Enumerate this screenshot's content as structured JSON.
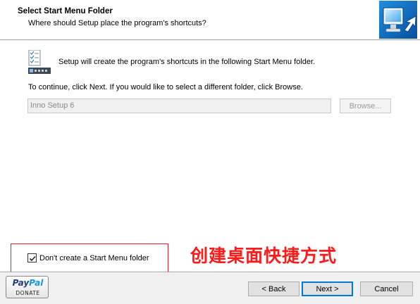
{
  "header": {
    "title": "Select Start Menu Folder",
    "subtitle": "Where should Setup place the program's shortcuts?",
    "logo_icon": "setup-wizard-logo-icon"
  },
  "main": {
    "info_text": "Setup will create the program's shortcuts in the following Start Menu folder.",
    "instruction_text": "To continue, click Next. If you would like to select a different folder, click Browse.",
    "folder_field": {
      "value": "Inno Setup 6",
      "disabled": true
    },
    "browse_label": "Browse...",
    "no_start_menu": {
      "label": "Don't create a Start Menu folder",
      "checked": true
    }
  },
  "annotation": {
    "text": "创建桌面快捷方式",
    "color": "#ff1a1a",
    "highlight_color": "#e0202a"
  },
  "footer": {
    "paypal": {
      "pay": "Pay",
      "pal": "Pal",
      "donate": "DONATE"
    },
    "back_label": "< Back",
    "next_label": "Next >",
    "cancel_label": "Cancel"
  },
  "colors": {
    "accent": "#0078d7",
    "paypal_dark": "#253b80",
    "paypal_light": "#179bd7"
  }
}
